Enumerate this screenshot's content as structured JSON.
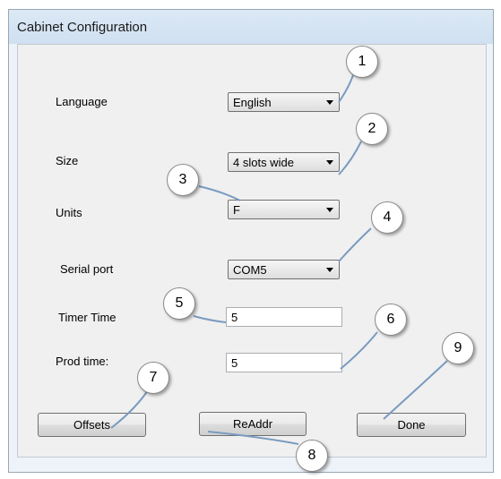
{
  "window": {
    "title": "Cabinet Configuration"
  },
  "form": {
    "language": {
      "label": "Language",
      "value": "English"
    },
    "size": {
      "label": "Size",
      "value": "4 slots wide"
    },
    "units": {
      "label": "Units",
      "value": "F"
    },
    "serial_port": {
      "label": "Serial port",
      "value": "COM5"
    },
    "timer_time": {
      "label": "Timer Time",
      "value": "5"
    },
    "prod_time": {
      "label": "Prod time:",
      "value": "5"
    }
  },
  "buttons": {
    "offsets": "Offsets",
    "readdr": "ReAddr",
    "done": "Done"
  },
  "callouts": [
    "1",
    "2",
    "3",
    "4",
    "5",
    "6",
    "7",
    "8",
    "9"
  ]
}
